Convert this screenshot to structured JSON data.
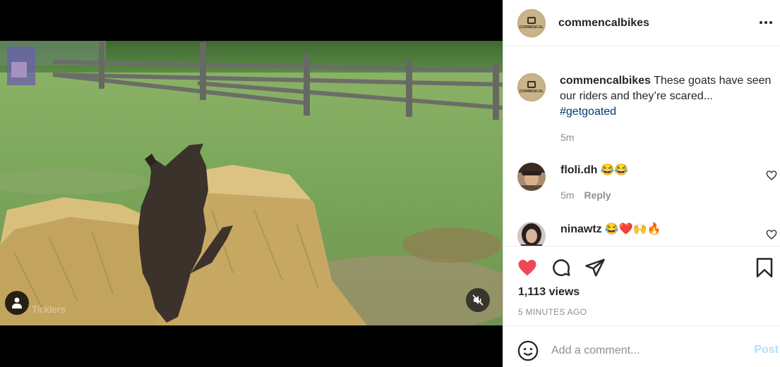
{
  "colors": {
    "like_red": "#ed4956",
    "link_blue": "#00376b",
    "post_disabled": "#b2dffc",
    "muted_gray": "#8e8e8e"
  },
  "video": {
    "watermark": "Ticklers",
    "user_tag_icon": "person-icon",
    "mute_icon": "speaker-muted-icon"
  },
  "post": {
    "username": "commencalbikes",
    "avatar_text": "COMMENCAL",
    "more_icon": "more-horizontal-icon"
  },
  "caption": {
    "username": "commencalbikes",
    "text": "These goats have seen our riders and they’re scared...",
    "hashtag": "#getgoated",
    "time": "5m"
  },
  "comments": [
    {
      "username": "floli.dh",
      "text": "😂😂",
      "time": "5m",
      "reply_label": "Reply"
    },
    {
      "username": "ninawtz",
      "text": "😂❤️🙌🔥"
    }
  ],
  "actions": {
    "like_icon": "heart-filled-icon",
    "comment_icon": "comment-icon",
    "share_icon": "send-icon",
    "save_icon": "bookmark-icon"
  },
  "stats": {
    "views": "1,113 views",
    "posted_ago": "5 MINUTES AGO"
  },
  "composer": {
    "placeholder": "Add a comment...",
    "post_label": "Post",
    "emoji_icon": "emoji-icon"
  }
}
